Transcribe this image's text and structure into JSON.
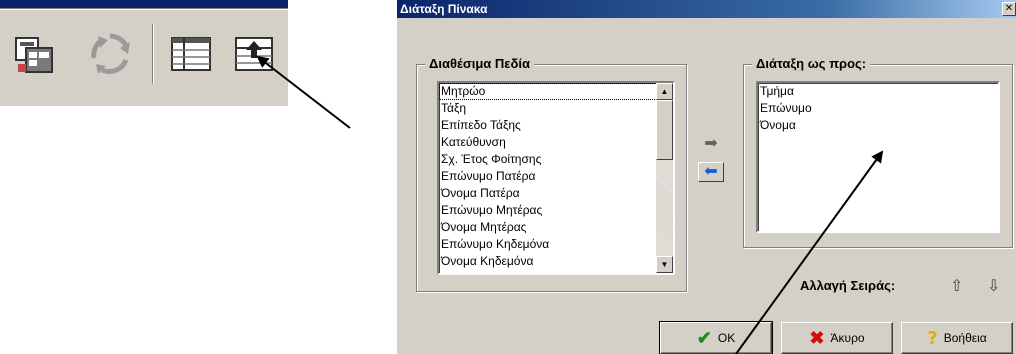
{
  "dialog": {
    "title": "Διάταξη Πίνακα",
    "available_fields": {
      "title": "Διαθέσιμα Πεδία",
      "items": [
        "Μητρώο",
        "Τάξη",
        "Επίπεδο Τάξης",
        "Κατεύθυνση",
        "Σχ. Έτος Φοίτησης",
        "Επώνυμο Πατέρα",
        "Όνομα Πατέρα",
        "Επώνυμο Μητέρας",
        "Όνομα Μητέρας",
        "Επώνυμο Κηδεμόνα",
        "Όνομα Κηδεμόνα"
      ]
    },
    "sort_by": {
      "title": "Διάταξη ως προς:",
      "items": [
        "Τμήμα",
        "Επώνυμο",
        "Όνομα"
      ]
    },
    "move_right_glyph": "➡",
    "move_left_glyph": "⬅",
    "change_order_label": "Αλλαγή Σειράς:",
    "buttons": {
      "ok": "OK",
      "cancel": "Άκυρο",
      "help": "Βοήθεια"
    }
  },
  "toolbar": {
    "icons": [
      "edit-record-icon",
      "refresh-icon",
      "table-view-icon",
      "sort-table-icon"
    ]
  },
  "colors": {
    "window_bg": "#d4d0c8",
    "title_start": "#0a246a",
    "title_end": "#a6caf0",
    "move_left_arrow": "#1060e0"
  }
}
